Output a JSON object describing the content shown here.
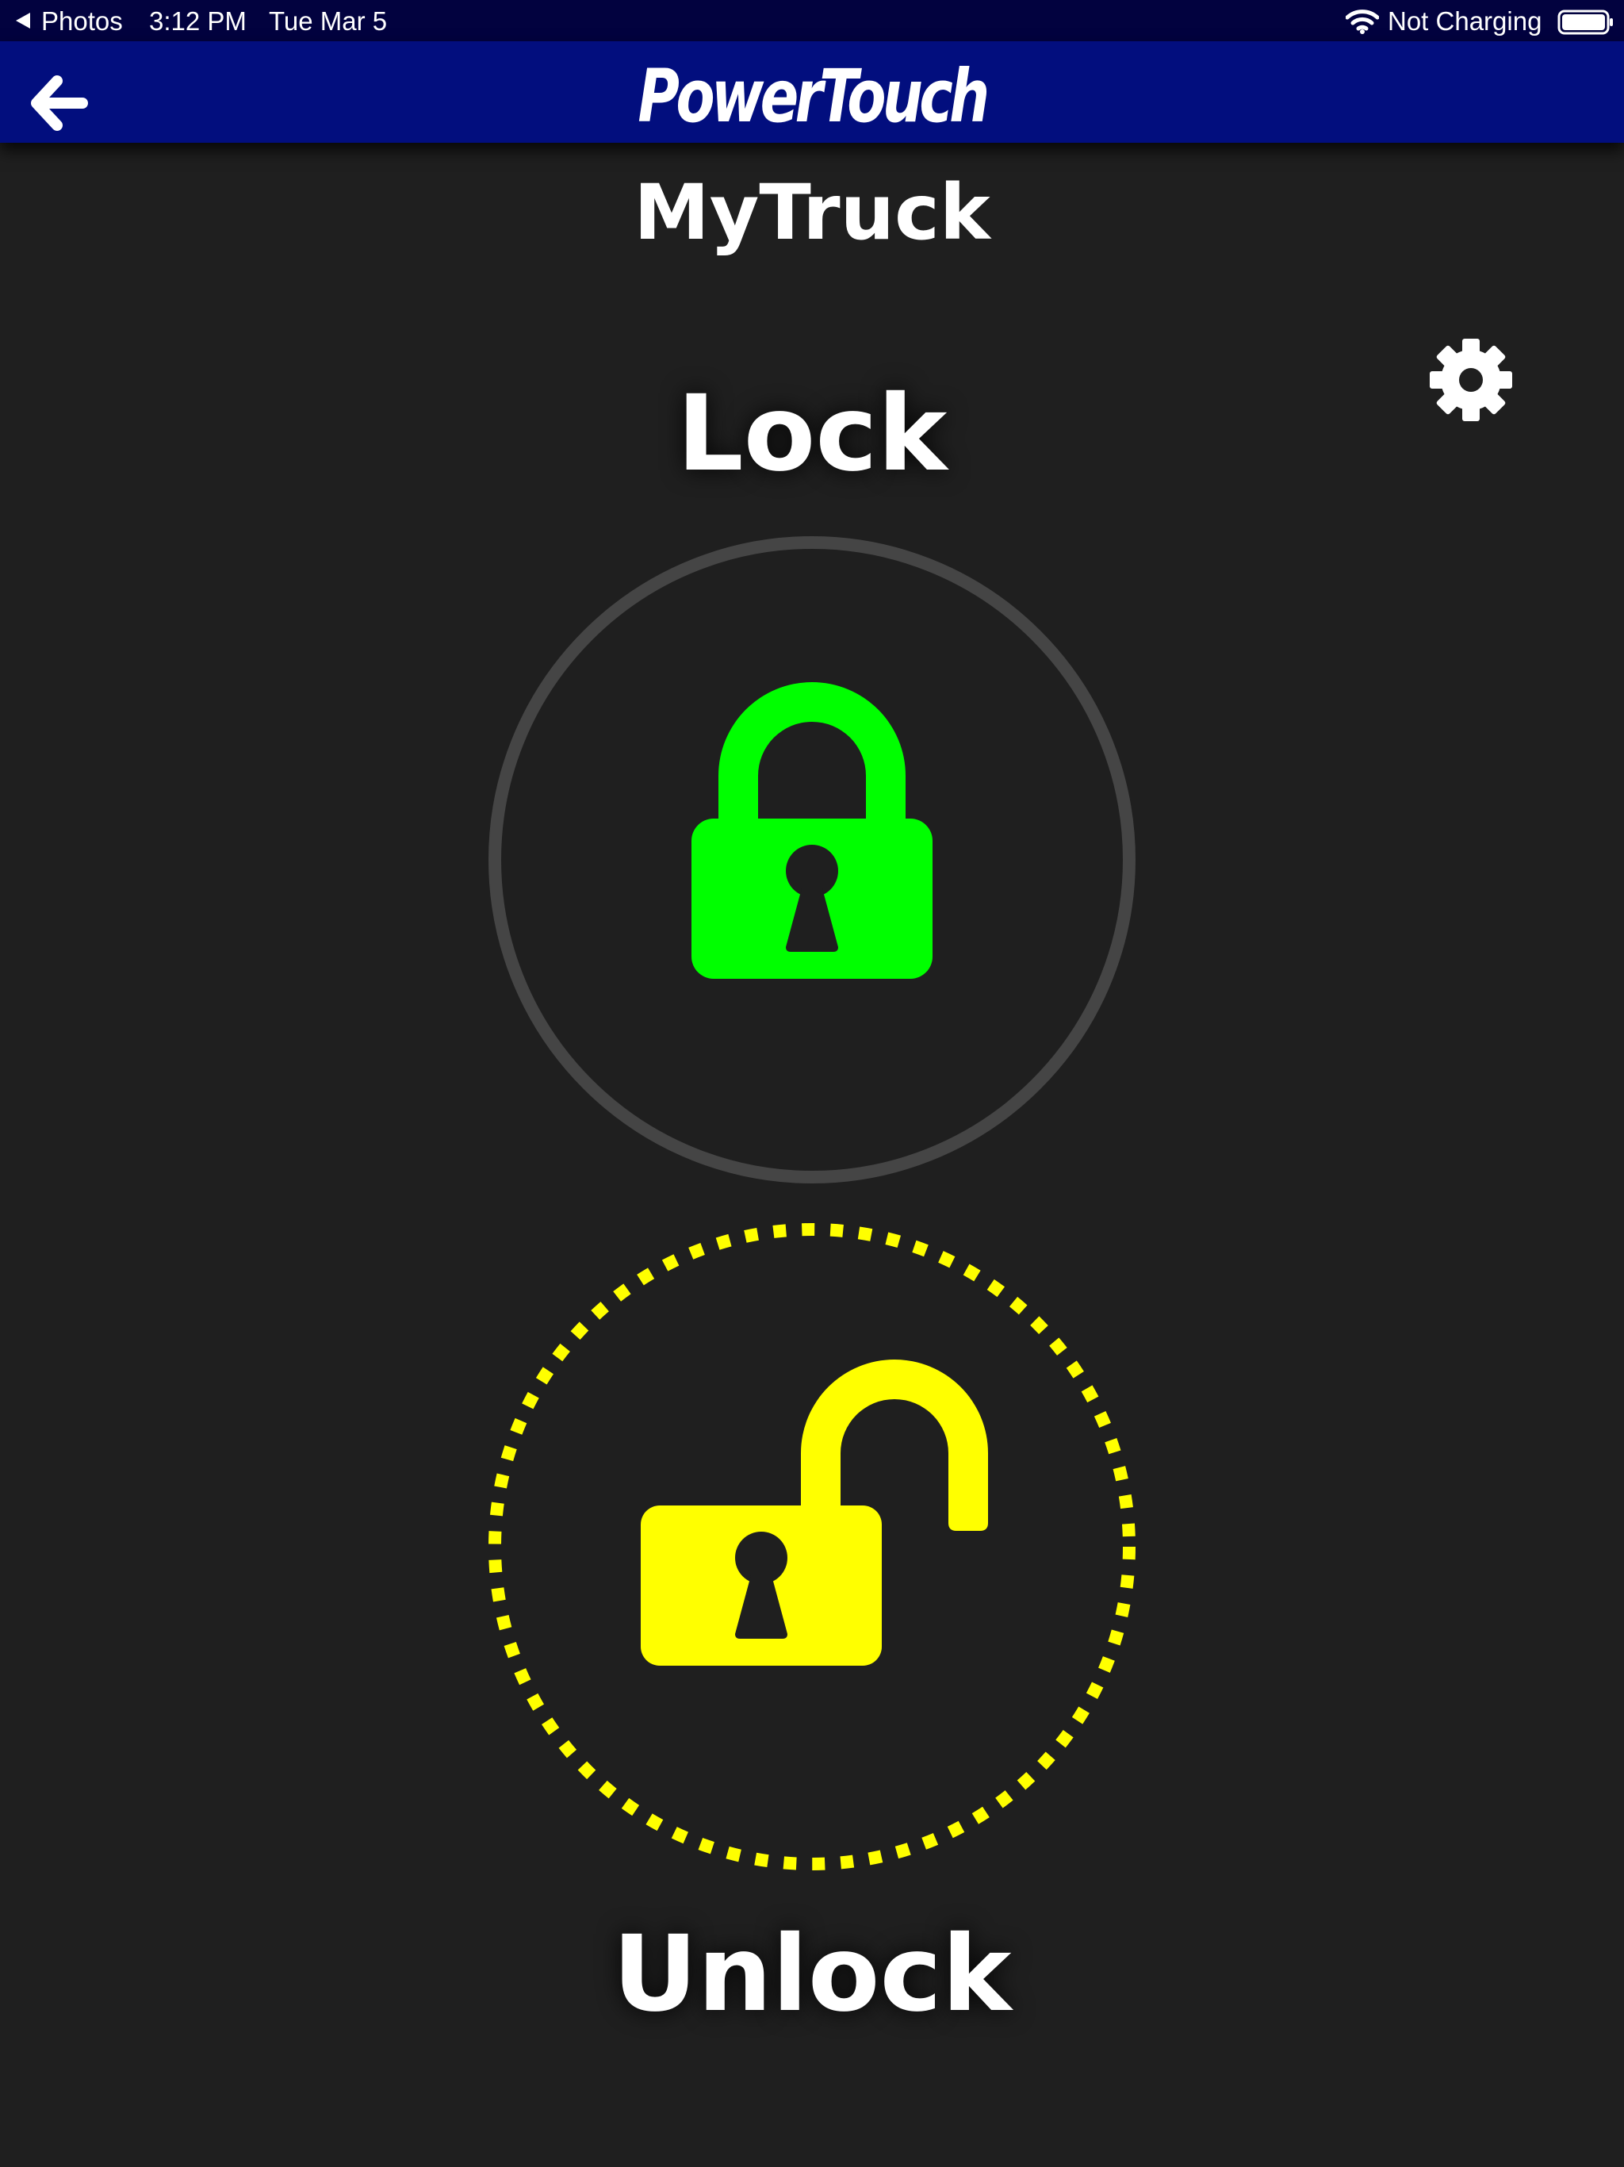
{
  "status_bar": {
    "back_app": "Photos",
    "time": "3:12 PM",
    "date": "Tue Mar 5",
    "charging_status": "Not Charging",
    "icons": [
      "back-caret-icon",
      "wifi-icon",
      "battery-icon"
    ]
  },
  "nav": {
    "brand": "PowerTouch",
    "back_icon": "arrow-left-icon"
  },
  "device": {
    "name": "MyTruck"
  },
  "controls": {
    "settings_icon": "gear-icon",
    "lock": {
      "label": "Lock",
      "icon": "lock-closed-icon",
      "ring_style": "solid",
      "color": "#00ff00",
      "ring_color": "#454545"
    },
    "unlock": {
      "label": "Unlock",
      "icon": "lock-open-icon",
      "ring_style": "dotted",
      "color": "#ffff00",
      "ring_color": "#ffff00",
      "active": true
    }
  },
  "colors": {
    "background": "#1f1f1f",
    "status_bar": "#02023f",
    "nav_bar": "#020e7e"
  }
}
